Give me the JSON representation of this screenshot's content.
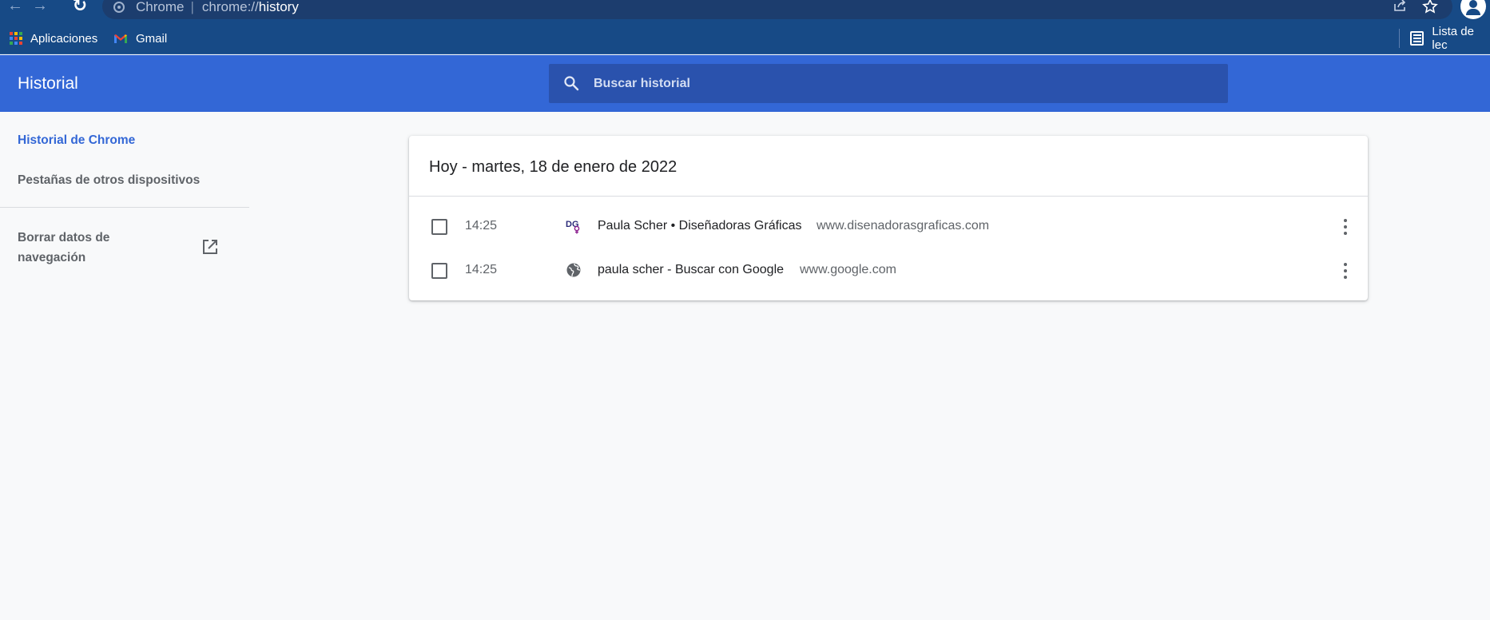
{
  "browser": {
    "omnibox": {
      "site_label": "Chrome",
      "separator": "|",
      "url_scheme": "chrome://",
      "url_path": "history"
    },
    "bookmarks": [
      {
        "label": "Aplicaciones",
        "icon": "apps-grid-icon"
      },
      {
        "label": "Gmail",
        "icon": "gmail-icon"
      }
    ],
    "reading_list_label": "Lista de lec"
  },
  "header": {
    "title": "Historial",
    "search_placeholder": "Buscar historial"
  },
  "sidebar": {
    "items": [
      {
        "label": "Historial de Chrome",
        "active": true
      },
      {
        "label": "Pestañas de otros dispositivos",
        "active": false
      }
    ],
    "clear_data_label": "Borrar datos de navegación"
  },
  "history": {
    "date_heading": "Hoy - martes, 18 de enero de 2022",
    "entries": [
      {
        "time": "14:25",
        "title": "Paula Scher • Diseñadoras Gráficas",
        "domain": "www.disenadorasgraficas.com",
        "favicon": "dg-logo-icon"
      },
      {
        "time": "14:25",
        "title": "paula scher - Buscar con Google",
        "domain": "www.google.com",
        "favicon": "globe-icon"
      }
    ]
  },
  "colors": {
    "browser_frame": "#174a86",
    "header_blue": "#3367d6",
    "search_bg": "#2a52ad",
    "active_link": "#3367d6",
    "dg_logo_purple": "#5b1f7a"
  }
}
